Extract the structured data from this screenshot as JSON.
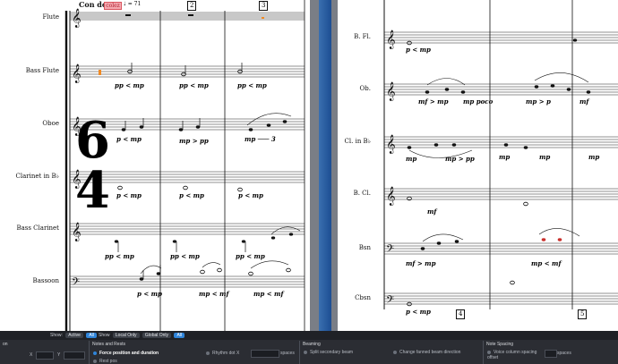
{
  "score": {
    "title_prefix": "Con do",
    "title_highlight": "colez",
    "tempo": "♩ = 71",
    "time_signature": {
      "top": "6",
      "bottom": "4"
    },
    "left_instruments": [
      "Flute",
      "Bass Flute",
      "Oboe",
      "Clarinet in B♭",
      "Bass Clarinet",
      "Bassoon"
    ],
    "left_bar_numbers": [
      "2",
      "3"
    ],
    "right_instruments": [
      "B. Fl.",
      "Ob.",
      "Cl. in B♭",
      "B. Cl.",
      "Bsn",
      "Cbsn"
    ],
    "right_bar_numbers": [
      "4",
      "5"
    ],
    "dynamics": {
      "pp_mp": "pp < mp",
      "mp_pp": "mp > pp",
      "mp_gt": "mp ─── 3",
      "p_mp": "p < mp",
      "p_mp_right": "p < mp",
      "mf": "mf",
      "mp": "mp",
      "mp_poco": "mp poco",
      "mf_mp": "mf > mp",
      "mp_p": "mp > p",
      "mp_mf": "mp < mf"
    }
  },
  "panel": {
    "filter": {
      "show_label_1": "Show:",
      "active": "Active",
      "all_1": "All",
      "show_label_2": "Show",
      "local_only": "Local Only",
      "global_only": "Global Only",
      "all_2": "All"
    },
    "sections": {
      "left_stub": "on",
      "x_label": "X",
      "y_label": "Y",
      "notes_rests_title": "Notes and Rests",
      "force_position": "Force position and duration",
      "rest_pos": "Rest pos",
      "rhythm_dot_x": "Rhythm dot X",
      "spaces_1": "spaces",
      "beaming_title": "Beaming",
      "split_secondary_beam": "Split secondary beam",
      "change_fanned": "Change fanned beam direction",
      "note_spacing_title": "Note Spacing",
      "voice_column": "Voice column spacing offset",
      "spaces_2": "spaces"
    }
  },
  "colors": {
    "accent": "#2f84d9",
    "highlight_note": "#f08a24",
    "selection_red": "#d9555f"
  }
}
